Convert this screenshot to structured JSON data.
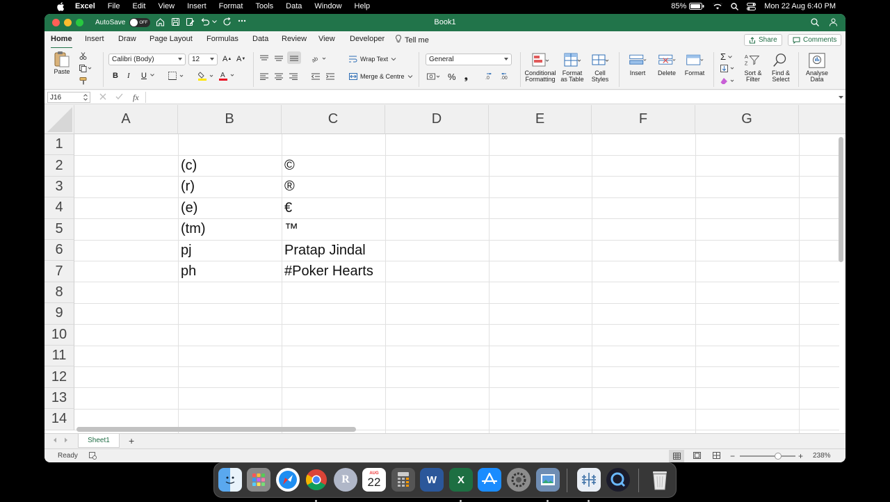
{
  "menubar": {
    "app": "Excel",
    "items": [
      "File",
      "Edit",
      "View",
      "Insert",
      "Format",
      "Tools",
      "Data",
      "Window",
      "Help"
    ],
    "battery": "85%",
    "datetime": "Mon 22 Aug  6:40 PM"
  },
  "window": {
    "title": "Book1",
    "autosave_label": "AutoSave",
    "autosave_state": "OFF"
  },
  "ribbon_tabs": [
    "Home",
    "Insert",
    "Draw",
    "Page Layout",
    "Formulas",
    "Data",
    "Review",
    "View",
    "Developer"
  ],
  "tell_me": "Tell me",
  "share_label": "Share",
  "comments_label": "Comments",
  "ribbon": {
    "paste": "Paste",
    "font_name": "Calibri (Body)",
    "font_size": "12",
    "bold": "B",
    "italic": "I",
    "underline": "U",
    "wrap_text": "Wrap Text",
    "merge_centre": "Merge & Centre",
    "number_format": "General",
    "percent": "%",
    "conditional_formatting": [
      "Conditional",
      "Formatting"
    ],
    "format_as_table": [
      "Format",
      "as Table"
    ],
    "cell_styles": [
      "Cell",
      "Styles"
    ],
    "insert": "Insert",
    "delete": "Delete",
    "format": "Format",
    "sort_filter": [
      "Sort &",
      "Filter"
    ],
    "find_select": [
      "Find &",
      "Select"
    ],
    "analyse_data": [
      "Analyse",
      "Data"
    ]
  },
  "formula_bar": {
    "name_box": "J16",
    "fx": "fx",
    "value": ""
  },
  "grid": {
    "columns": [
      "A",
      "B",
      "C",
      "D",
      "E",
      "F",
      "G"
    ],
    "rows": [
      "1",
      "2",
      "3",
      "4",
      "5",
      "6",
      "7",
      "8",
      "9",
      "10",
      "11",
      "12",
      "13",
      "14"
    ],
    "cells": {
      "B2": "(c)",
      "C2": "©",
      "B3": "(r)",
      "C3": "®",
      "B4": "(e)",
      "C4": "€",
      "B5": "(tm)",
      "C5": "™",
      "B6": "pj",
      "C6": "Pratap Jindal",
      "B7": "ph",
      "C7": "#Poker Hearts"
    }
  },
  "sheet": {
    "tab": "Sheet1",
    "add": "+"
  },
  "status": {
    "ready": "Ready",
    "zoom": "238%"
  },
  "dock": {
    "calendar_month": "AUG",
    "calendar_day": "22"
  },
  "colors": {
    "excel_green": "#21744a",
    "accent": "#1e6b43"
  }
}
